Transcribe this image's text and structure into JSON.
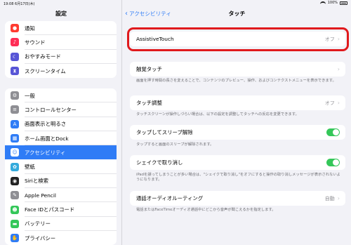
{
  "status_bar": {
    "time": "19:08",
    "date": "6月17日(木)",
    "battery": "100%"
  },
  "sidebar": {
    "title": "設定",
    "group1": [
      {
        "label": "通知",
        "icon": "notification-icon",
        "color": "#ff3b30",
        "glyph": "●"
      },
      {
        "label": "サウンド",
        "icon": "sound-icon",
        "color": "#ff2d55",
        "glyph": "♪"
      },
      {
        "label": "おやすみモード",
        "icon": "moon-icon",
        "color": "#5856d6",
        "glyph": "☾"
      },
      {
        "label": "スクリーンタイム",
        "icon": "hourglass-icon",
        "color": "#5856d6",
        "glyph": "⧗"
      }
    ],
    "group2": [
      {
        "label": "一般",
        "icon": "gear-icon",
        "color": "#8e8e93",
        "glyph": "⚙"
      },
      {
        "label": "コントロールセンター",
        "icon": "switches-icon",
        "color": "#8e8e93",
        "glyph": "≡"
      },
      {
        "label": "画面表示と明るさ",
        "icon": "text-size-icon",
        "color": "#2f7cf6",
        "glyph": "A"
      },
      {
        "label": "ホーム画面とDock",
        "icon": "home-grid-icon",
        "color": "#2f7cf6",
        "glyph": "▦"
      },
      {
        "label": "アクセシビリティ",
        "icon": "accessibility-icon",
        "color": "#2f7cf6",
        "glyph": "☺"
      },
      {
        "label": "壁紙",
        "icon": "wallpaper-icon",
        "color": "#34aadc",
        "glyph": "✿"
      },
      {
        "label": "Siriと検索",
        "icon": "siri-icon",
        "color": "#222222",
        "glyph": "◉"
      },
      {
        "label": "Apple Pencil",
        "icon": "pencil-icon",
        "color": "#8e8e93",
        "glyph": "✎"
      },
      {
        "label": "Face IDとパスコード",
        "icon": "face-id-icon",
        "color": "#34c759",
        "glyph": "☻"
      },
      {
        "label": "バッテリー",
        "icon": "battery-icon",
        "color": "#34c759",
        "glyph": "▬"
      },
      {
        "label": "プライバシー",
        "icon": "hand-icon",
        "color": "#2f7cf6",
        "glyph": "✋"
      }
    ]
  },
  "main": {
    "back_label": "アクセシビリティ",
    "title": "タッチ",
    "assistive_touch": {
      "label": "AssistiveTouch",
      "value": "オフ"
    },
    "haptic_touch": {
      "label": "触覚タッチ",
      "desc": "画面を押す時間の長さを変えることで、コンテンツのプレビュー、操作、およびコンテクストメニューを表示できます。"
    },
    "touch_accommodations": {
      "label": "タッチ調整",
      "value": "オフ",
      "desc": "タッチスクリーンが操作しづらい場合は、以下の設定を調整してタッチへの反応を変更できます。"
    },
    "tap_to_wake": {
      "label": "タップしてスリープ解除",
      "on": true,
      "desc": "タップすると画面のスリープが解除されます。"
    },
    "shake_to_undo": {
      "label": "シェイクで取り消し",
      "on": true,
      "desc": "iPadを誤ってしまうことが多い場合は、\"シェイクで取り消し\"をオフにすると操作の取り消しメッセージが表示されないようになります。"
    },
    "call_audio_routing": {
      "label": "通話オーディオルーティング",
      "value": "自動",
      "desc": "電話またはFaceTimeオーディオ通話中にどこから音声が聞こえるかを指定します。"
    }
  }
}
